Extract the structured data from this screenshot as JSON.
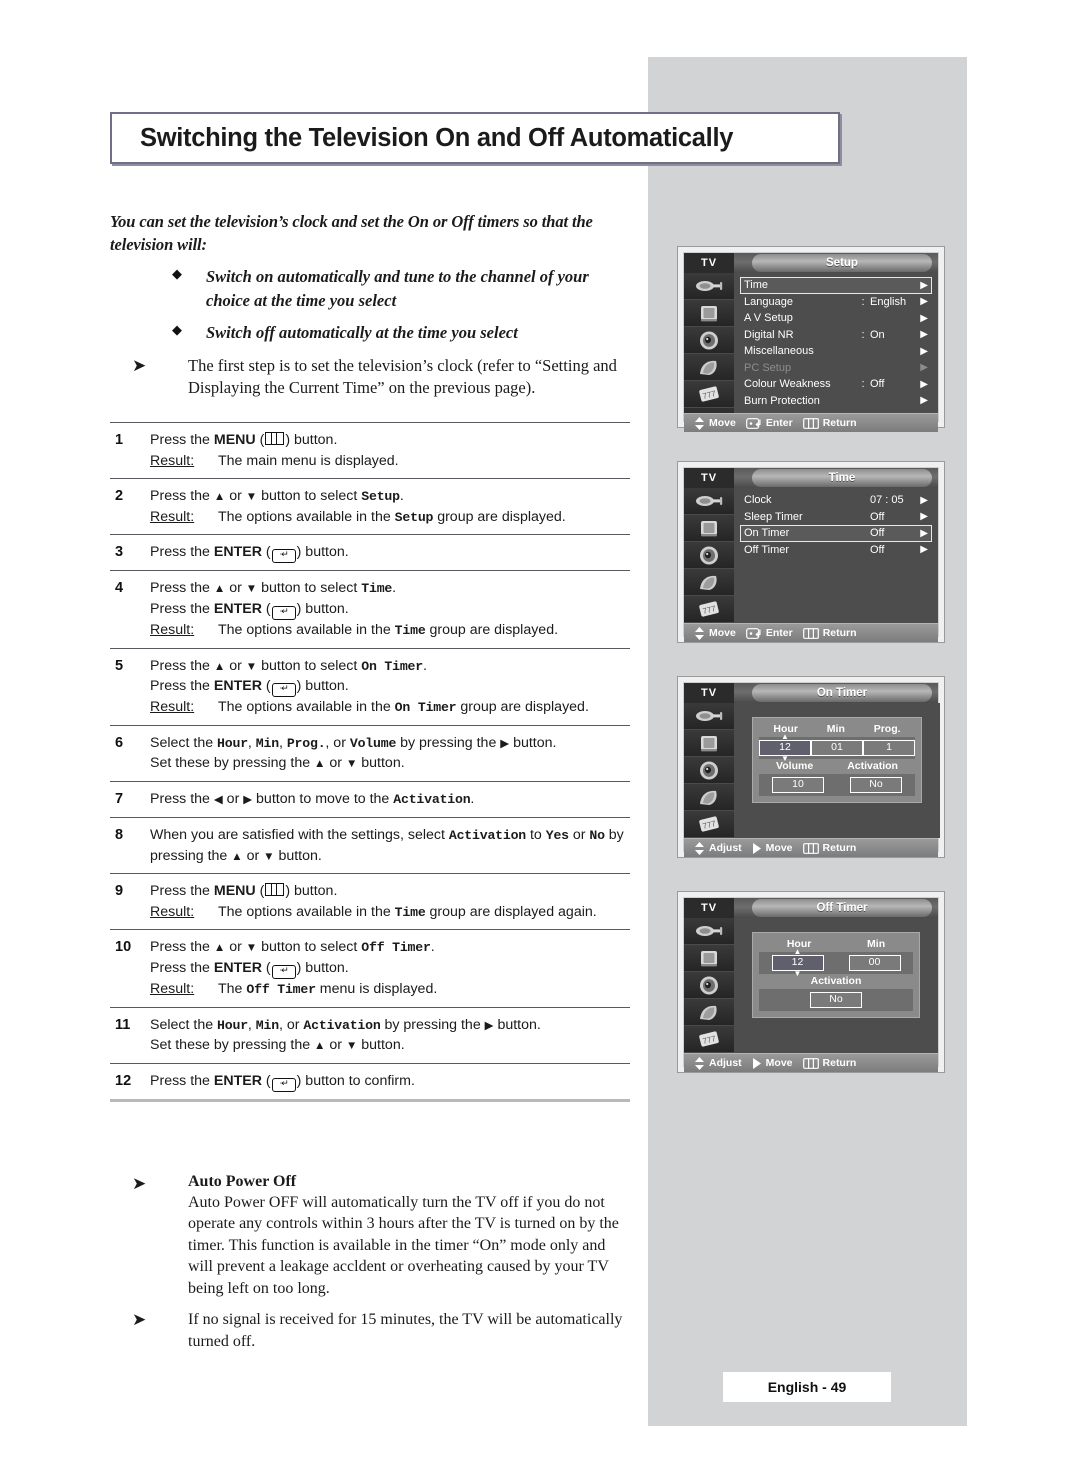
{
  "page": {
    "title": "Switching the Television On and Off Automatically",
    "footer_label": "English - 49"
  },
  "intro": {
    "paragraph": "You can set the television’s clock and set the On or Off timers so that the television will:",
    "bullets": [
      "Switch on automatically and tune to the channel of your choice at the time you select",
      "Switch off automatically at the time you select"
    ],
    "note": "The first step is to set the television’s clock (refer to “Setting and Displaying the Current Time” on the previous page)."
  },
  "labels": {
    "result": "Result",
    "result_colon": ":",
    "menu_key": "MENU",
    "enter_key": "ENTER",
    "enter_glyph": "↵"
  },
  "steps": [
    {
      "num": "1",
      "lines": [
        "Press the |MENU| (#MENU#) button."
      ],
      "result": "The main menu is displayed."
    },
    {
      "num": "2",
      "lines": [
        "Press the #UP# or #DOWN# button to select `Setup`."
      ],
      "result": "The options available in the `Setup` group are displayed."
    },
    {
      "num": "3",
      "lines": [
        "Press the |ENTER| (#ENTER#) button."
      ],
      "result": ""
    },
    {
      "num": "4",
      "lines": [
        "Press the #UP# or #DOWN# button to select `Time`.",
        "Press the |ENTER| (#ENTER#) button."
      ],
      "result": "The options available in the `Time` group are displayed."
    },
    {
      "num": "5",
      "lines": [
        "Press the #UP# or #DOWN# button to select `On Timer`.",
        "Press the |ENTER| (#ENTER#) button."
      ],
      "result": "The options available in the `On Timer` group are displayed."
    },
    {
      "num": "6",
      "lines": [
        "Select the `Hour`, `Min`, `Prog.`, or `Volume` by pressing the #RIGHT# button.",
        "Set these by pressing the #UP# or #DOWN# button."
      ],
      "result": ""
    },
    {
      "num": "7",
      "lines": [
        "Press the #LEFT# or #RIGHT# button to move to the `Activation`."
      ],
      "result": ""
    },
    {
      "num": "8",
      "lines": [
        "When you are satisfied with the settings, select `Activation` to `Yes` or `No` by pressing the #UP# or #DOWN# button."
      ],
      "result": ""
    },
    {
      "num": "9",
      "lines": [
        "Press the |MENU| (#MENU#) button."
      ],
      "result": "The options available in the `Time` group are displayed again."
    },
    {
      "num": "10",
      "lines": [
        "Press the #UP# or #DOWN# button to select `Off Timer`.",
        "Press the |ENTER| (#ENTER#) button."
      ],
      "result": "The `Off Timer` menu is displayed."
    },
    {
      "num": "11",
      "lines": [
        "Select the `Hour`, `Min`, or `Activation` by pressing the #RIGHT# button.",
        "Set these by pressing the #UP# or #DOWN# button."
      ],
      "result": ""
    },
    {
      "num": "12",
      "lines": [
        "Press the |ENTER| (#ENTER#) button to confirm."
      ],
      "result": ""
    }
  ],
  "notes": [
    {
      "heading": "Auto Power Off",
      "body": "Auto Power OFF will automatically turn the TV off if you do not operate any controls within 3 hours after the TV is turned on by the timer. This function is available in the timer “On” mode only and will prevent a leakage accldent or overheating caused by your TV being left on too long."
    },
    {
      "heading": "",
      "body": "If no signal is received for 15 minutes, the TV will be automatically turned off."
    }
  ],
  "osd": {
    "source_label": "TV",
    "footer_variants": {
      "move": {
        "move": "Move",
        "enter": "Enter",
        "return": "Return"
      },
      "adjust": {
        "adjust": "Adjust",
        "move": "Move",
        "return": "Return"
      }
    },
    "menus": [
      {
        "id": "setup",
        "title": "Setup",
        "rows": [
          {
            "label": "Time",
            "colon": "",
            "value": "",
            "selected": true,
            "dim": false,
            "arrow": "▶"
          },
          {
            "label": "Language",
            "colon": ":",
            "value": "English",
            "selected": false,
            "dim": false,
            "arrow": "▶"
          },
          {
            "label": "A V Setup",
            "colon": "",
            "value": "",
            "selected": false,
            "dim": false,
            "arrow": "▶"
          },
          {
            "label": "Digital NR",
            "colon": ":",
            "value": "On",
            "selected": false,
            "dim": false,
            "arrow": "▶"
          },
          {
            "label": "Miscellaneous",
            "colon": "",
            "value": "",
            "selected": false,
            "dim": false,
            "arrow": "▶"
          },
          {
            "label": "PC Setup",
            "colon": "",
            "value": "",
            "selected": false,
            "dim": true,
            "arrow": "▶"
          },
          {
            "label": "Colour Weakness",
            "colon": ":",
            "value": "Off",
            "selected": false,
            "dim": false,
            "arrow": "▶"
          },
          {
            "label": "Burn Protection",
            "colon": "",
            "value": "",
            "selected": false,
            "dim": false,
            "arrow": "▶"
          }
        ],
        "footer": [
          "Move",
          "Enter",
          "Return"
        ]
      },
      {
        "id": "time",
        "title": "Time",
        "rows": [
          {
            "label": "Clock",
            "colon": "",
            "value": "07 : 05",
            "selected": false,
            "dim": false,
            "arrow": "▶"
          },
          {
            "label": "Sleep Timer",
            "colon": "",
            "value": "Off",
            "selected": false,
            "dim": false,
            "arrow": "▶"
          },
          {
            "label": "On Timer",
            "colon": "",
            "value": "Off",
            "selected": true,
            "dim": false,
            "arrow": "▶"
          },
          {
            "label": "Off Timer",
            "colon": "",
            "value": "Off",
            "selected": false,
            "dim": false,
            "arrow": "▶"
          }
        ],
        "footer": [
          "Move",
          "Enter",
          "Return"
        ]
      },
      {
        "id": "on-timer",
        "title": "On Timer",
        "fields_row1": [
          {
            "label": "Hour",
            "value": "12",
            "spinner": true
          },
          {
            "label": "Min",
            "value": "01",
            "spinner": false
          },
          {
            "label": "Prog.",
            "value": "1",
            "spinner": false
          }
        ],
        "fields_row2": [
          {
            "label": "Volume",
            "value": "10",
            "spinner": false
          },
          {
            "label": "Activation",
            "value": "No",
            "spinner": false
          }
        ],
        "footer": [
          "Adjust",
          "Move",
          "Return"
        ]
      },
      {
        "id": "off-timer",
        "title": "Off Timer",
        "fields_row1": [
          {
            "label": "Hour",
            "value": "12",
            "spinner": true
          },
          {
            "label": "Min",
            "value": "00",
            "spinner": false
          }
        ],
        "fields_row2": [
          {
            "label": "Activation",
            "value": "No",
            "spinner": false
          }
        ],
        "footer": [
          "Adjust",
          "Move",
          "Return"
        ]
      }
    ]
  }
}
